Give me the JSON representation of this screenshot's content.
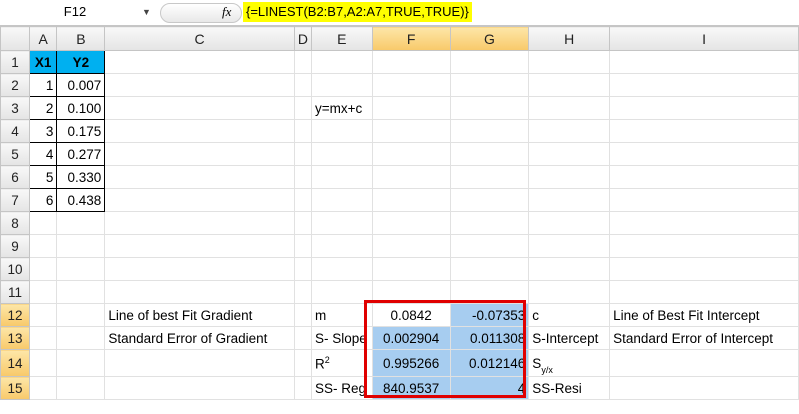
{
  "formula_bar": {
    "name_box": "F12",
    "fx_icon": "function-icon",
    "formula": "{=LINEST(B2:B7,A2:A7,TRUE,TRUE)}"
  },
  "columns": [
    "",
    "A",
    "B",
    "C",
    "D",
    "E",
    "F",
    "G",
    "H",
    "I"
  ],
  "rows": [
    [
      "1",
      "X1",
      "Y2",
      "",
      "",
      "",
      "",
      "",
      "",
      ""
    ],
    [
      "2",
      "1",
      "0.007",
      "",
      "",
      "",
      "",
      "",
      "",
      ""
    ],
    [
      "3",
      "2",
      "0.100",
      "",
      "",
      "y=mx+c",
      "",
      "",
      "",
      ""
    ],
    [
      "4",
      "3",
      "0.175",
      "",
      "",
      "",
      "",
      "",
      "",
      ""
    ],
    [
      "5",
      "4",
      "0.277",
      "",
      "",
      "",
      "",
      "",
      "",
      ""
    ],
    [
      "6",
      "5",
      "0.330",
      "",
      "",
      "",
      "",
      "",
      "",
      ""
    ],
    [
      "7",
      "6",
      "0.438",
      "",
      "",
      "",
      "",
      "",
      "",
      ""
    ],
    [
      "8",
      "",
      "",
      "",
      "",
      "",
      "",
      "",
      "",
      ""
    ],
    [
      "9",
      "",
      "",
      "",
      "",
      "",
      "",
      "",
      "",
      ""
    ],
    [
      "10",
      "",
      "",
      "",
      "",
      "",
      "",
      "",
      "",
      ""
    ],
    [
      "11",
      "",
      "",
      "",
      "",
      "",
      "",
      "",
      "",
      ""
    ],
    [
      "12",
      "",
      "",
      "Line of best Fit Gradient",
      "",
      "m",
      "0.0842",
      "-0.07353",
      "c",
      "Line of Best Fit Intercept"
    ],
    [
      "13",
      "",
      "",
      "Standard Error of Gradient",
      "",
      "S- Slope",
      "0.002904",
      "0.011308",
      "S-Intercept",
      "Standard Error of Intercept"
    ],
    [
      "14",
      "",
      "",
      "",
      "",
      "R²",
      "0.995266",
      "0.012146",
      "Sy/x",
      ""
    ],
    [
      "15",
      "",
      "",
      "",
      "",
      "SS- Reg",
      "840.9537",
      "4",
      "SS-Resi",
      ""
    ]
  ],
  "selection": {
    "active_cell": "F12",
    "range": "F12:G15",
    "fill_color": "#a7cdf0",
    "outline_color": "#e00000"
  },
  "header_fill_color": "#00b0f0"
}
